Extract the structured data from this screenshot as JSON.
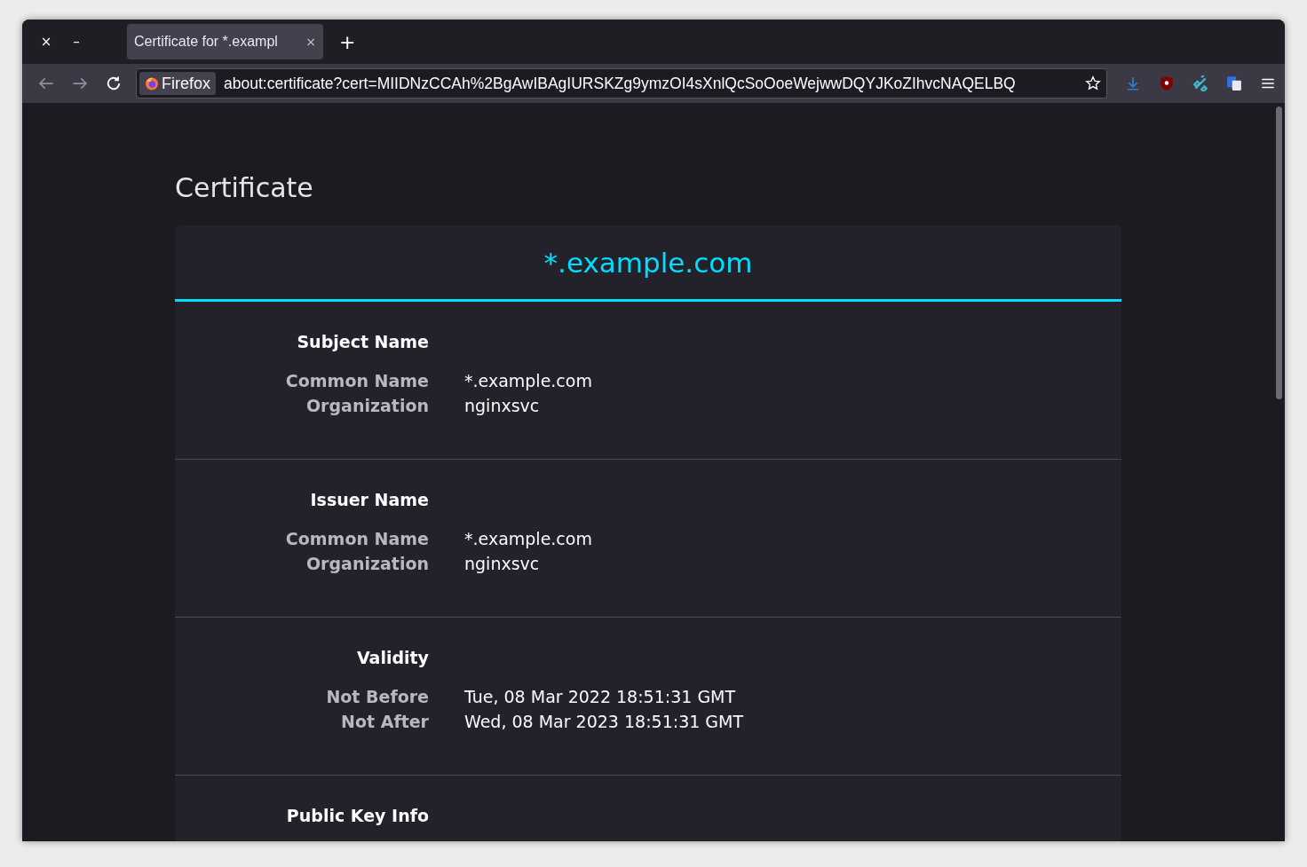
{
  "window_controls": [
    "×",
    "–"
  ],
  "tabs": [
    {
      "title": "Certificate for *.exampl",
      "close": "×",
      "selected": true
    }
  ],
  "new_tab": "+",
  "address_bar": {
    "identity": "Firefox",
    "url": "about:certificate?cert=MIIDNzCCAh%2BgAwIBAgIURSKZg9ymzOI4sXnlQcSoOoeWejwwDQYJKoZIhvcNAQELBQ"
  },
  "page": {
    "heading": "Certificate",
    "card_title": "*.example.com",
    "sections": [
      {
        "title": "Subject Name",
        "rows": [
          {
            "label": "Common Name",
            "value": "*.example.com"
          },
          {
            "label": "Organization",
            "value": "nginxsvc"
          }
        ]
      },
      {
        "title": "Issuer Name",
        "rows": [
          {
            "label": "Common Name",
            "value": "*.example.com"
          },
          {
            "label": "Organization",
            "value": "nginxsvc"
          }
        ]
      },
      {
        "title": "Validity",
        "rows": [
          {
            "label": "Not Before",
            "value": "Tue, 08 Mar 2022 18:51:31 GMT"
          },
          {
            "label": "Not After",
            "value": "Wed, 08 Mar 2023 18:51:31 GMT"
          }
        ]
      },
      {
        "title": "Public Key Info"
      }
    ]
  }
}
